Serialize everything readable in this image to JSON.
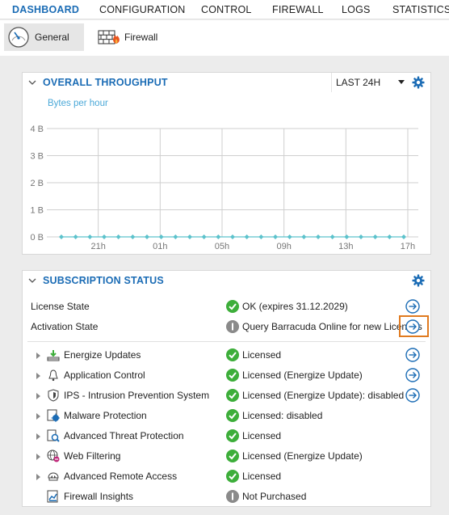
{
  "nav": {
    "tabs": [
      {
        "label": "DASHBOARD",
        "active": true
      },
      {
        "label": "CONFIGURATION",
        "active": false
      },
      {
        "label": "CONTROL",
        "active": false
      },
      {
        "label": "FIREWALL",
        "active": false
      },
      {
        "label": "LOGS",
        "active": false
      },
      {
        "label": "STATISTICS",
        "active": false
      }
    ]
  },
  "subtabs": [
    {
      "label": "General",
      "icon": "speedometer-icon",
      "active": true
    },
    {
      "label": "Firewall",
      "icon": "firewall-icon",
      "active": false
    }
  ],
  "throughput": {
    "title": "OVERALL THROUGHPUT",
    "range": "LAST 24H",
    "subtitle": "Bytes per hour"
  },
  "chart_data": {
    "type": "line",
    "title": "OVERALL THROUGHPUT",
    "ylabel": "Bytes per hour",
    "ylim": [
      0,
      4
    ],
    "yticks": [
      "0 B",
      "1 B",
      "2 B",
      "3 B",
      "4 B"
    ],
    "xticks": [
      "21h",
      "01h",
      "05h",
      "09h",
      "13h",
      "17h"
    ],
    "grid": true,
    "series": [
      {
        "values": [
          0,
          0,
          0,
          0,
          0,
          0,
          0,
          0,
          0,
          0,
          0,
          0,
          0,
          0,
          0,
          0,
          0,
          0,
          0,
          0,
          0,
          0,
          0,
          0,
          0
        ]
      }
    ],
    "colors": {
      "line": "#5cc2cc",
      "grid": "#cfcfcf"
    }
  },
  "subscription": {
    "title": "SUBSCRIPTION STATUS",
    "license": {
      "label": "License State",
      "value": "OK (expires 31.12.2029)",
      "status": "ok"
    },
    "activation": {
      "label": "Activation State",
      "value": "Query Barracuda Online for new Licenses",
      "status": "info"
    },
    "features": [
      {
        "label": "Energize Updates",
        "value": "Licensed",
        "status": "ok",
        "icon": "download-icon",
        "arrow": true
      },
      {
        "label": "Application Control",
        "value": "Licensed (Energize Update)",
        "status": "ok",
        "icon": "bell-icon",
        "arrow": true
      },
      {
        "label": "IPS - Intrusion Prevention System",
        "value": "Licensed (Energize Update): disabled",
        "status": "ok",
        "icon": "shield-icon",
        "arrow": true
      },
      {
        "label": "Malware Protection",
        "value": "Licensed: disabled",
        "status": "ok",
        "icon": "malware-icon",
        "arrow": false
      },
      {
        "label": "Advanced Threat Protection",
        "value": "Licensed",
        "status": "ok",
        "icon": "document-scan-icon",
        "arrow": false
      },
      {
        "label": "Web Filtering",
        "value": "Licensed (Energize Update)",
        "status": "ok",
        "icon": "web-filter-icon",
        "arrow": false
      },
      {
        "label": "Advanced Remote Access",
        "value": "Licensed",
        "status": "ok",
        "icon": "remote-access-icon",
        "arrow": false
      },
      {
        "label": "Firewall Insights",
        "value": "Not Purchased",
        "status": "info",
        "icon": "insights-icon",
        "arrow": false
      }
    ]
  },
  "colors": {
    "accent": "#1b6cb5",
    "ok": "#3dae3a",
    "info": "#8a8a8a",
    "highlight": "#e07a1f"
  }
}
